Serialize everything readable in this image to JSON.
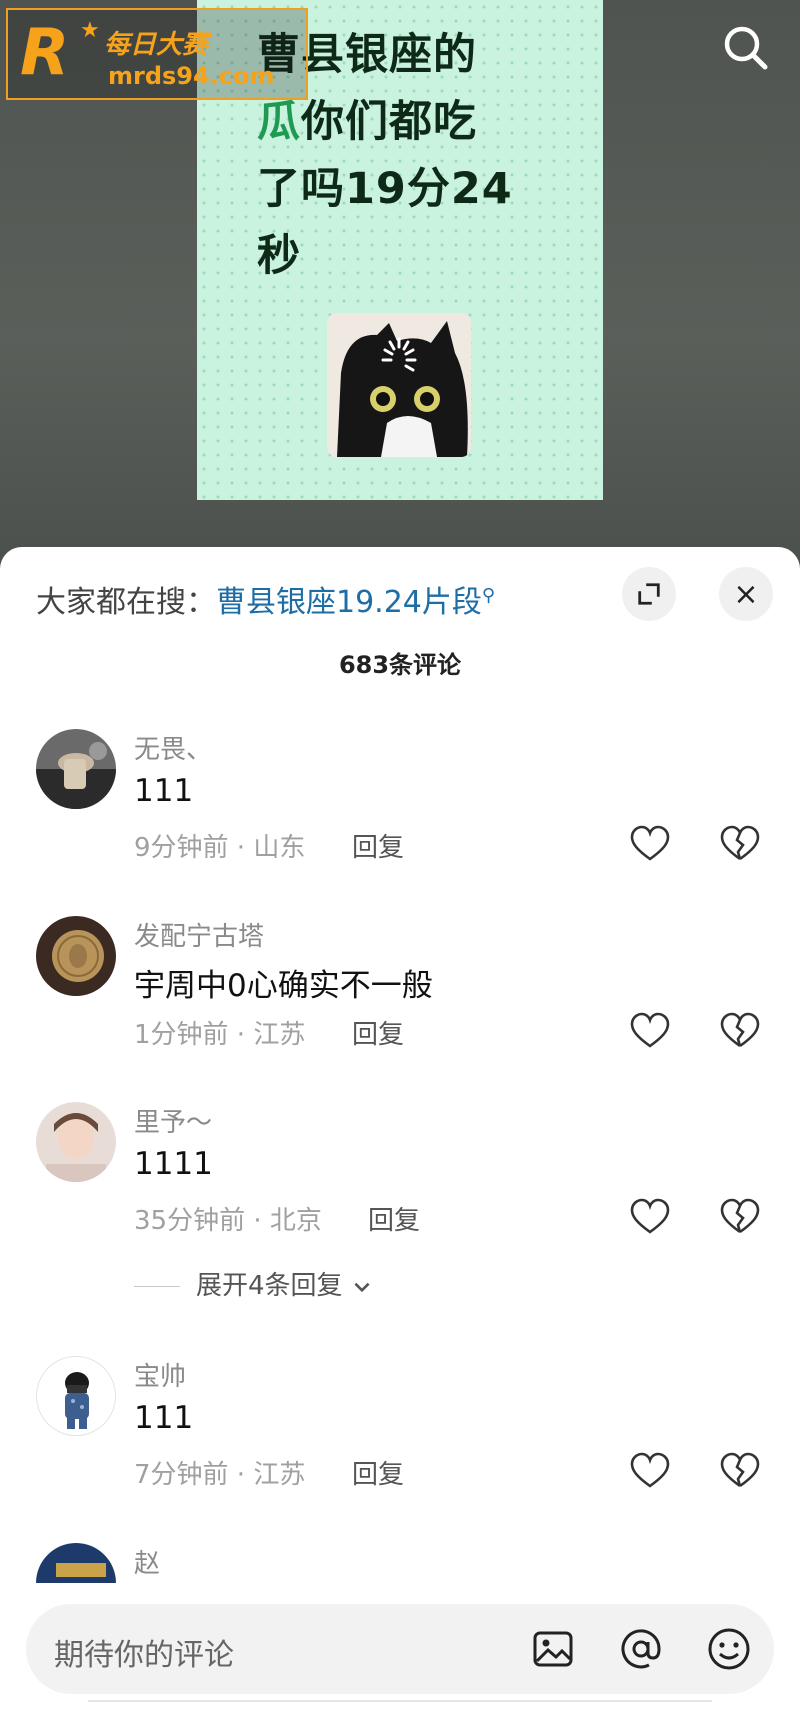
{
  "video": {
    "title_line1": "曹县银座的",
    "title_green": "瓜",
    "title_line2_rest": "你们都吃",
    "title_line3": "了吗19分24",
    "title_line4": "秒"
  },
  "watermark": {
    "logo": "R",
    "cn": "每日大赛",
    "url": "mrds94.com"
  },
  "top_icons": {
    "search": "search-icon"
  },
  "sheet": {
    "hot_label": "大家都在搜：",
    "hot_keyword": "曹县银座19.24片段",
    "comment_count": "683条评论",
    "expand_icon": "expand-icon",
    "close_label": "×"
  },
  "comments": [
    {
      "name": "无畏、",
      "text": "111",
      "time_loc": "9分钟前 · 山东",
      "reply": "回复"
    },
    {
      "name": "发配宁古塔",
      "text": "宇周中0心确实不一般",
      "time_loc": "1分钟前 · 江苏",
      "reply": "回复"
    },
    {
      "name": "里予～",
      "text": "1111",
      "time_loc": "35分钟前 · 北京",
      "reply": "回复",
      "expand": "展开4条回复"
    },
    {
      "name": "宝帅",
      "text": "111",
      "time_loc": "7分钟前 · 江苏",
      "reply": "回复"
    },
    {
      "name": "赵"
    }
  ],
  "input": {
    "placeholder": "期待你的评论",
    "icons": [
      "image-icon",
      "at-icon",
      "emoji-icon"
    ]
  },
  "colors": {
    "accent_blue": "#1e6ea6",
    "title_green": "#1f9a53",
    "watermark_orange": "#f7a21b"
  }
}
